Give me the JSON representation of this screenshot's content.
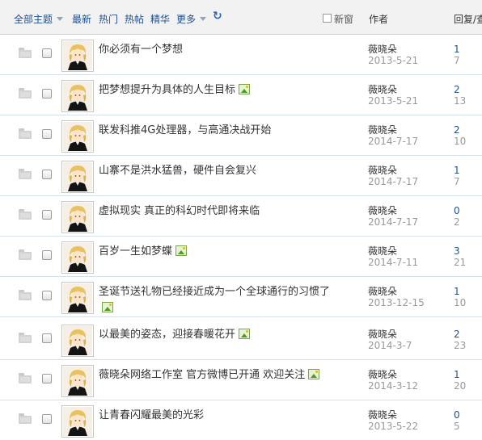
{
  "header": {
    "filter_label": "全部主题",
    "tabs": [
      "最新",
      "热门",
      "热帖",
      "精华"
    ],
    "more_label": "更多",
    "refresh_icon": "refresh-icon",
    "new_window_label": "新窗",
    "author_col": "作者",
    "reply_col": "回复/查"
  },
  "threads": [
    {
      "title": "你必须有一个梦想",
      "has_image": false,
      "author": "薇晓朵",
      "date": "2013-5-21",
      "replies": "1",
      "views": "7"
    },
    {
      "title": "把梦想提升为具体的人生目标",
      "has_image": true,
      "author": "薇晓朵",
      "date": "2013-5-21",
      "replies": "2",
      "views": "13"
    },
    {
      "title": "联发科推4G处理器，与高通决战开始",
      "has_image": false,
      "author": "薇晓朵",
      "date": "2014-7-17",
      "replies": "2",
      "views": "10"
    },
    {
      "title": "山寨不是洪水猛兽，硬件自会复兴",
      "has_image": false,
      "author": "薇晓朵",
      "date": "2014-7-17",
      "replies": "1",
      "views": "7"
    },
    {
      "title": "虚拟现实 真正的科幻时代即将来临",
      "has_image": false,
      "author": "薇晓朵",
      "date": "2014-7-17",
      "replies": "0",
      "views": "2"
    },
    {
      "title": "百岁一生如梦蝶",
      "has_image": true,
      "author": "薇晓朵",
      "date": "2014-7-11",
      "replies": "3",
      "views": "21"
    },
    {
      "title": "圣诞节送礼物已经接近成为一个全球通行的习惯了",
      "has_image": true,
      "author": "薇晓朵",
      "date": "2013-12-15",
      "replies": "1",
      "views": "10"
    },
    {
      "title": "以最美的姿态，迎接春暖花开",
      "has_image": true,
      "author": "薇晓朵",
      "date": "2014-3-7",
      "replies": "2",
      "views": "23"
    },
    {
      "title": "薇晓朵网络工作室 官方微博已开通 欢迎关注",
      "has_image": true,
      "author": "薇晓朵",
      "date": "2014-3-12",
      "replies": "1",
      "views": "20"
    },
    {
      "title": "让青春闪耀最美的光彩",
      "has_image": false,
      "author": "薇晓朵",
      "date": "2013-5-22",
      "replies": "0",
      "views": "5"
    }
  ],
  "colors": {
    "link": "#1f4f8f",
    "muted": "#999999",
    "header_bg": "#f2f2f2",
    "row_border": "#d6e0ec"
  }
}
